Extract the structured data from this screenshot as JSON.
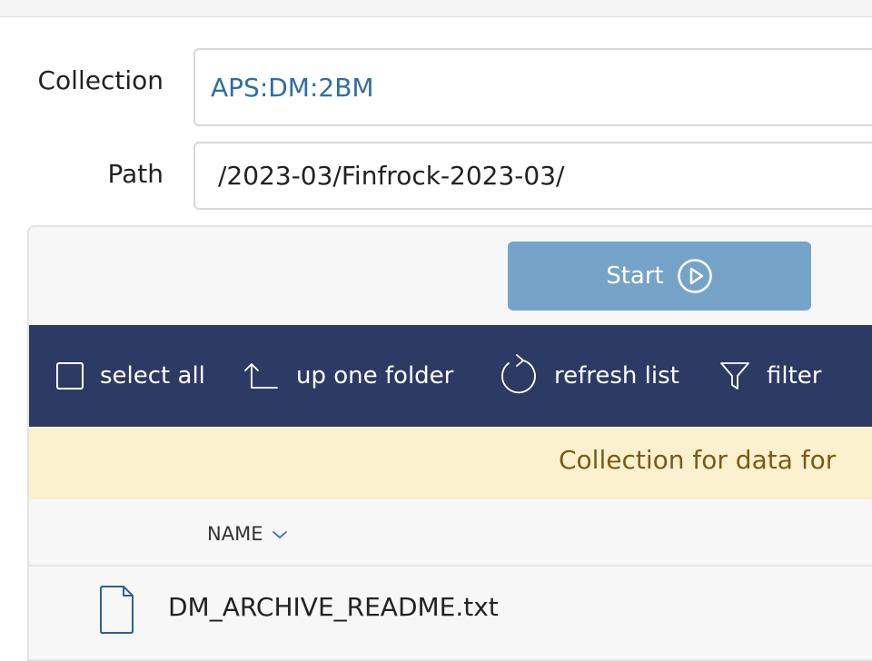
{
  "form": {
    "collection_label": "Collection",
    "collection_value": "APS:DM:2BM",
    "path_label": "Path",
    "path_value": "/2023-03/Finfrock-2023-03/"
  },
  "panel": {
    "start_label": "Start",
    "toolbar": {
      "select_all": "select all",
      "up_one_folder": "up one folder",
      "refresh_list": "refresh list",
      "filter": "filter"
    },
    "notice_text": "Collection for data for",
    "columns": {
      "name_header": "NAME"
    },
    "files": [
      {
        "name": "DM_ARCHIVE_README.txt",
        "icon": "file-icon"
      }
    ]
  },
  "colors": {
    "toolbar_bg": "#2d3a64",
    "start_button_bg": "#76a4c8",
    "notice_bg": "#fcf1cf",
    "notice_text": "#7a5b14",
    "link_blue": "#2e6ea6"
  }
}
